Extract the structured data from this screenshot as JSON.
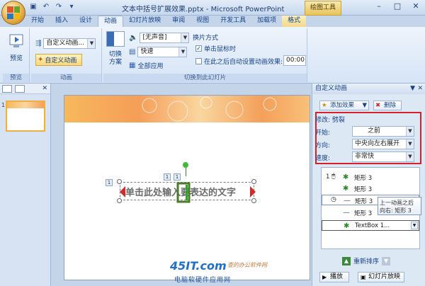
{
  "titlebar": {
    "title": "文本中括号扩展效果.pptx - Microsoft PowerPoint",
    "contextual_tab": "绘图工具"
  },
  "tabs": [
    "开始",
    "插入",
    "设计",
    "动画",
    "幻灯片放映",
    "审阅",
    "视图",
    "开发工具",
    "加载项",
    "格式"
  ],
  "ribbon": {
    "preview": {
      "button": "预览",
      "group": "预览"
    },
    "animation": {
      "combo": "自定义动画...",
      "custom_button": "自定义动画",
      "group": "动画"
    },
    "transition": {
      "switch_label": "切换\n方案",
      "sound": "[无声音]",
      "speed": "快速",
      "apply_all": "全部应用",
      "mode_title": "换片方式",
      "on_click": "单击鼠标时",
      "auto_after": "在此之后自动设置动画效果:",
      "time": "00:00",
      "group": "切换到此幻灯片"
    }
  },
  "slide": {
    "number": "1",
    "placeholder_text": "单击此处输入要表达的文字",
    "tags": [
      "1",
      "1",
      "1"
    ]
  },
  "taskpane": {
    "title": "自定义动画",
    "add_effect": "添加效果",
    "delete": "删除",
    "modify": "修改: 劈裂",
    "start_label": "开始:",
    "start_value": "之前",
    "direction_label": "方向:",
    "direction_value": "中央向左右展开",
    "speed_label": "速度:",
    "speed_value": "非常快",
    "effects": [
      {
        "num": "1",
        "label": "矩形 3"
      },
      {
        "num": "",
        "label": "矩形 3"
      },
      {
        "num": "",
        "label": "矩形 3"
      },
      {
        "num": "",
        "label": "矩形 3"
      },
      {
        "num": "",
        "label": "TextBox 1..."
      }
    ],
    "tooltip": [
      "上一动画之后",
      "向右: 矩形 3"
    ],
    "reorder": "重新排序",
    "play": "播放",
    "slideshow": "幻灯片放映"
  },
  "watermark": {
    "logo": "45IT.com",
    "subtitle": "电脑软硬件应用网",
    "site": "查的办公软件网"
  },
  "colors": {
    "accent": "#15428b",
    "highlight": "#d8202a",
    "ribbon": "#d6e4f6"
  }
}
